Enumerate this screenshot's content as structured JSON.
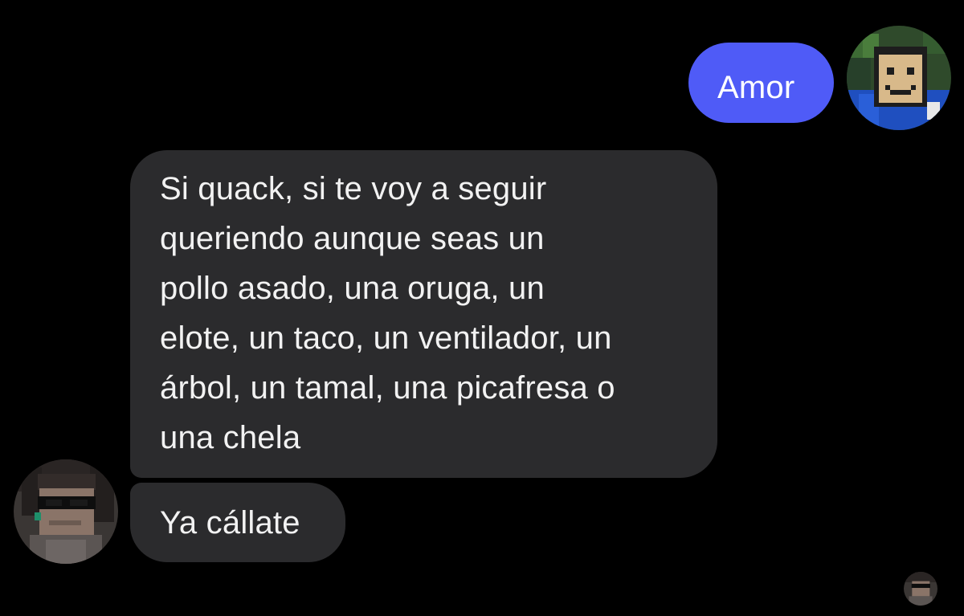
{
  "colors": {
    "background": "#000000",
    "outgoing_bubble": "#4f5bf7",
    "incoming_bubble": "#2b2b2d",
    "outgoing_text": "#ffffff",
    "incoming_text": "#f2f2f2"
  },
  "conversation": {
    "messages": [
      {
        "direction": "outgoing",
        "lines": [
          "Amor"
        ]
      },
      {
        "direction": "incoming",
        "lines": [
          "Si quack, si te voy a seguir",
          "queriendo aunque seas un",
          "pollo asado, una oruga, un",
          "elote, un taco, un ventilador, un",
          "árbol, un tamal, una picafresa o",
          "una chela"
        ]
      },
      {
        "direction": "incoming",
        "lines": [
          "Ya cállate"
        ]
      }
    ],
    "avatars": {
      "self": "minecraft-skin-smiling-face-avatar",
      "other": "minecraft-skin-sunglasses-avatar",
      "read_receipt": "minecraft-skin-sunglasses-avatar"
    }
  }
}
